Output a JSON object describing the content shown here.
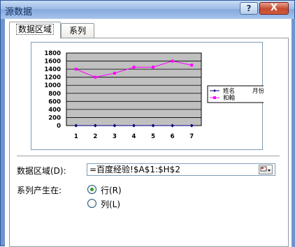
{
  "window": {
    "title": "源数据",
    "help": "?",
    "close": "X"
  },
  "tabs": [
    {
      "label": "数据区域",
      "active": true
    },
    {
      "label": "系列",
      "active": false
    }
  ],
  "chart_data": {
    "type": "line",
    "categories": [
      "1",
      "2",
      "3",
      "4",
      "5",
      "6",
      "7"
    ],
    "y_ticks": [
      "0",
      "200",
      "400",
      "600",
      "800",
      "1000",
      "1200",
      "1400",
      "1600",
      "1800"
    ],
    "ylim": [
      0,
      1800
    ],
    "grid": true,
    "legend_position": "right",
    "series": [
      {
        "name": "姓名",
        "extra_label": "月份",
        "color": "#000080",
        "values": [
          0,
          0,
          0,
          0,
          0,
          0,
          0
        ]
      },
      {
        "name": "和翰",
        "color": "#ff00ff",
        "values": [
          1400,
          1200,
          1300,
          1450,
          1450,
          1600,
          1500
        ]
      }
    ]
  },
  "data_range": {
    "label": "数据区域(D):",
    "value": "=百度经验!$A$1:$H$2",
    "picker_icon": "range-picker-icon"
  },
  "series_in": {
    "label": "系列产生在:",
    "options": [
      {
        "label": "行(R)",
        "checked": true
      },
      {
        "label": "列(L)",
        "checked": false
      }
    ]
  }
}
